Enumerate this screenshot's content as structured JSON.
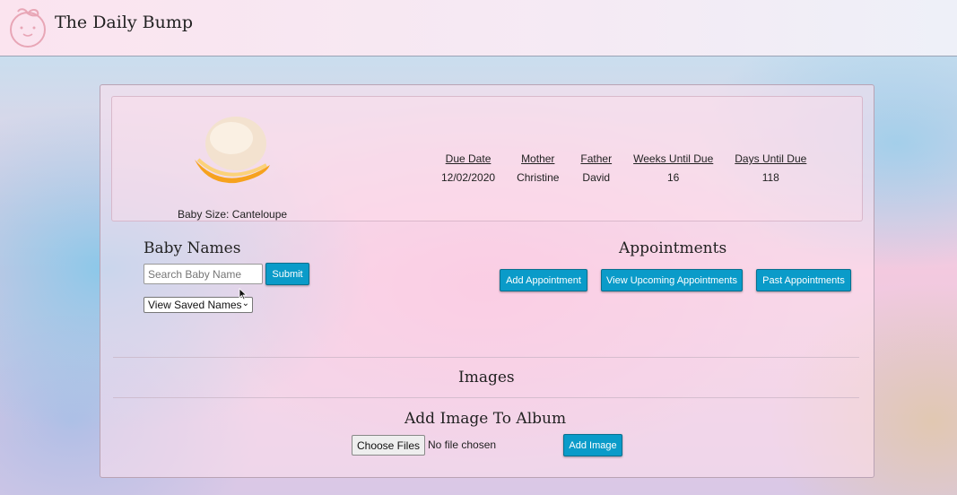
{
  "app": {
    "brand": "The Daily Bump"
  },
  "baby": {
    "size_label": "Baby Size: Canteloupe"
  },
  "stats": {
    "headers": [
      "Due Date",
      "Mother",
      "Father",
      "Weeks Until Due",
      "Days Until Due"
    ],
    "values": [
      "12/02/2020",
      "Christine",
      "David",
      "16",
      "118"
    ]
  },
  "baby_names": {
    "heading": "Baby Names",
    "search_placeholder": "Search Baby Name",
    "submit_label": "Submit",
    "saved_select": "View Saved Names"
  },
  "appointments": {
    "heading": "Appointments",
    "add_label": "Add Appointment",
    "upcoming_label": "View Upcoming Appointments",
    "past_label": "Past Appointments"
  },
  "images": {
    "heading": "Images",
    "album_heading": "Add Image To Album",
    "choose_label": "Choose Files",
    "no_file_text": "No file chosen",
    "add_label": "Add Image"
  },
  "colors": {
    "button": "#0a9bc9",
    "accent_pink": "#f5b4d7"
  }
}
